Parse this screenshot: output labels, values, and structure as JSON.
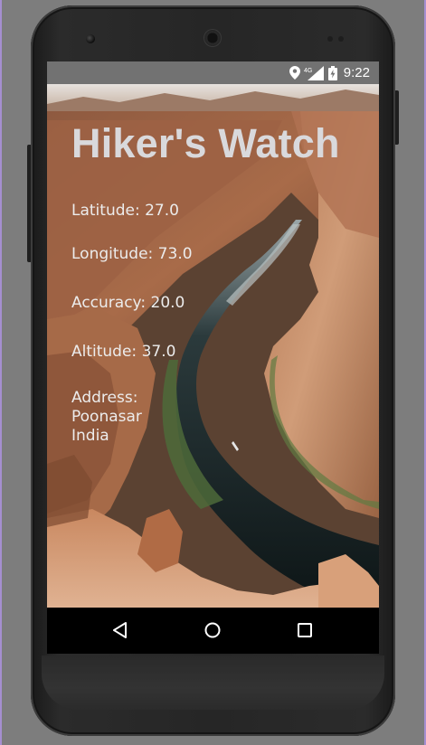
{
  "status_bar": {
    "time": "9:22",
    "network_label": "4G",
    "icons": [
      "location-icon",
      "signal-icon",
      "battery-icon"
    ]
  },
  "app": {
    "title": "Hiker's Watch",
    "latitude": "Latitude: 27.0",
    "longitude": "Longitude: 73.0",
    "accuracy": "Accuracy: 20.0",
    "altitude": "Altitude: 37.0",
    "address_label": "Address:",
    "address_line1": "Poonasar",
    "address_line2": "India",
    "background": "canyon-river-photo"
  },
  "nav_bar": {
    "icons": [
      "back-icon",
      "home-icon",
      "recents-icon"
    ]
  },
  "colors": {
    "status_bar": "#727272",
    "title_text": "#d9d9dc",
    "info_text": "#ececec",
    "nav_bar": "#000000"
  }
}
